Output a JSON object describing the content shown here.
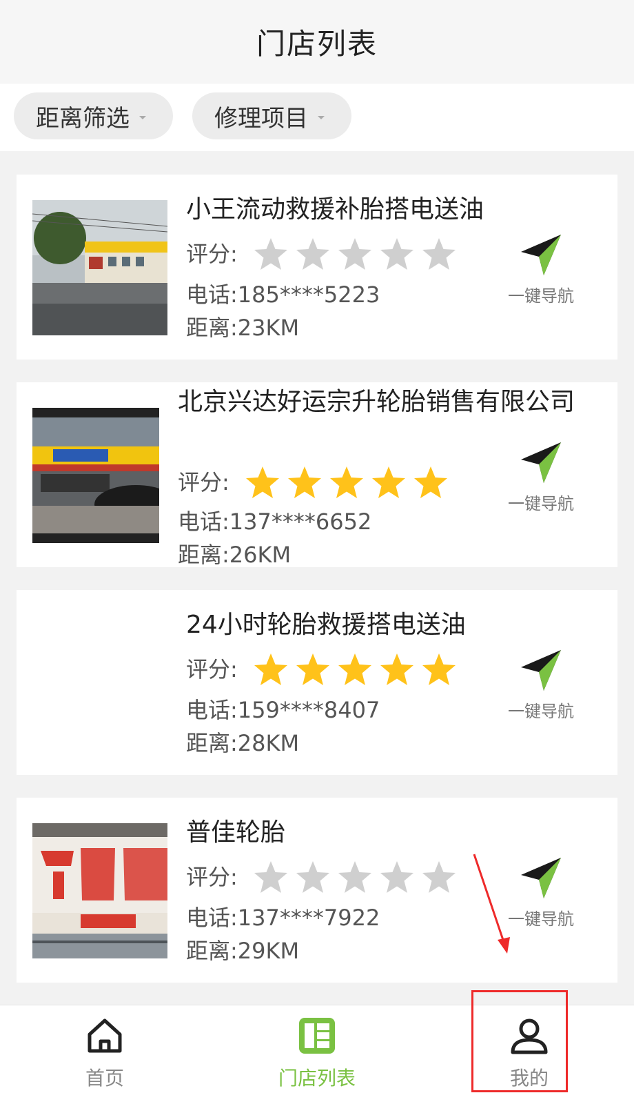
{
  "header": {
    "title": "门店列表"
  },
  "filters": [
    {
      "label": "距离筛选"
    },
    {
      "label": "修理项目"
    }
  ],
  "labels": {
    "rating": "评分:",
    "phone": "电话:",
    "distance": "距离:",
    "navigate": "一键导航"
  },
  "stores": [
    {
      "name": "小王流动救援补胎搭电送油",
      "rating": 0,
      "phone": "185****5223",
      "distance": "23KM",
      "photo": "roadside-shop-photo"
    },
    {
      "name": "北京兴达好运宗升轮胎销售有限公司",
      "rating": 5,
      "phone": "137****6652",
      "distance": "26KM",
      "photo": "tire-shop-photo"
    },
    {
      "name": "24小时轮胎救援搭电送油",
      "rating": 5,
      "phone": "159****8407",
      "distance": "28KM",
      "photo": ""
    },
    {
      "name": "普佳轮胎",
      "rating": 0,
      "phone": "137****7922",
      "distance": "29KM",
      "photo": "michelin-sign-photo"
    }
  ],
  "tabbar": {
    "home": "首页",
    "stores": "门店列表",
    "mine": "我的"
  },
  "colors": {
    "accent": "#7ac142",
    "star_active": "#ffc21a",
    "star_inactive": "#cfcfcf",
    "annotation": "#ee2a2a"
  }
}
